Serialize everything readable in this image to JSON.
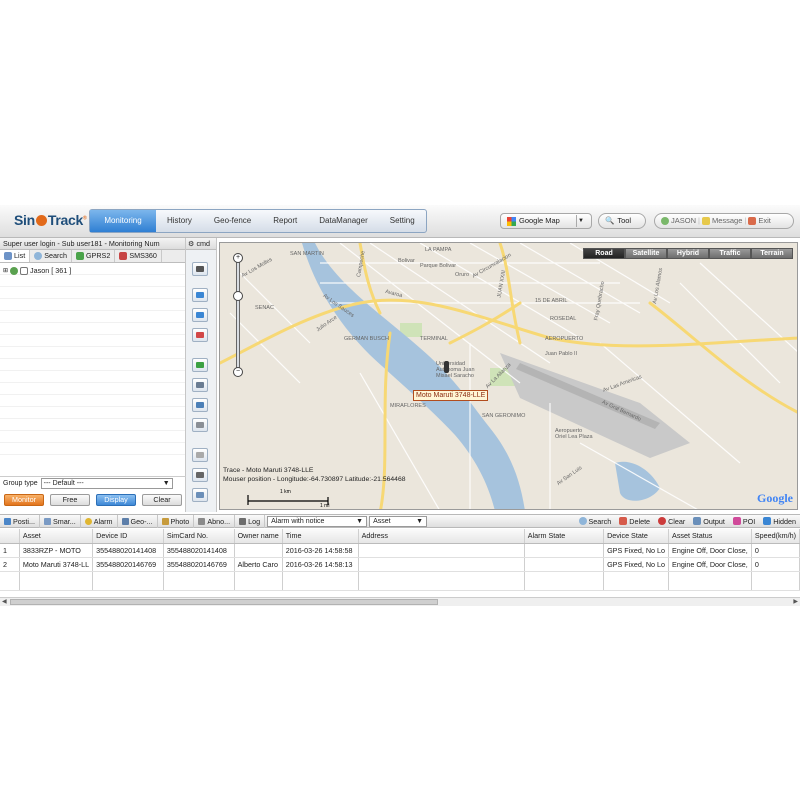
{
  "brand": {
    "name_a": "Sin",
    "name_b": "Track",
    "reg": "®"
  },
  "nav": [
    "Monitoring",
    "History",
    "Geo-fence",
    "Report",
    "DataManager",
    "Setting"
  ],
  "map_select": "Google Map",
  "tool_button": "Tool",
  "user": {
    "name": "JASON",
    "message": "Message",
    "exit": "Exit"
  },
  "left": {
    "title": "Super user login - Sub user181 - Monitoring Num",
    "tabs": [
      "List",
      "Search",
      "GPRS2",
      "SMS360"
    ],
    "tree": [
      {
        "label": "Jason [ 361 ]"
      }
    ],
    "group_label": "Group type",
    "group_value": "--- Default ---",
    "buttons": [
      "Monitor",
      "Free",
      "Display",
      "Clear"
    ]
  },
  "cmd": "cmd",
  "map": {
    "types": [
      "Road",
      "Satellite",
      "Hybrid",
      "Traffic",
      "Terrain"
    ],
    "labels": [
      "SAN MARTIN",
      "LA PAMPA",
      "Parque Bolivar",
      "Bolivar",
      "Campeche",
      "Oruro",
      "Av Circunvalacion",
      "JUAN XXIII",
      "15 DE ABRIL",
      "ROSEDAL",
      "SENAC",
      "Av Los Sauces",
      "Julio Arce",
      "Avaroa",
      "Av Los Molles",
      "GERMAN BUSCH",
      "TERMINAL",
      "AEROPUERTO",
      "Juan Pablo II",
      "Universidad Autonoma Juan Misael Saracho",
      "MIRAFLORES",
      "SAN GERONIMO",
      "Av La Alianza",
      "Aeropuerto Oriel Lea Plaza",
      "Av Las Americas",
      "Av San Luis",
      "Av Gral Bernardo",
      "Av Los Alamos",
      "Fray Quebracho"
    ],
    "vehicle": "Moto Maruti 3748-LLE",
    "trace": "Trace - Moto Maruti 3748-LLE",
    "mouse": "Mouser position - Longitude:-64.730897 Latitude:-21.564468",
    "scale_km": "1 km",
    "scale_mi": "1 mi",
    "google": "Google"
  },
  "grid_tabs": [
    "Posti...",
    "Smar...",
    "Alarm",
    "Geo-...",
    "Photo",
    "Abno...",
    "Log"
  ],
  "grid_selects": [
    "Alarm with notice",
    "Asset"
  ],
  "grid_actions": [
    "Search",
    "Delete",
    "Clear",
    "Output",
    "POI",
    "Hidden"
  ],
  "table": {
    "columns": [
      "",
      "Asset",
      "Device ID",
      "SimCard No.",
      "Owner name",
      "Time",
      "Address",
      "Alarm State",
      "Device State",
      "Asset Status",
      "Speed(km/h)"
    ],
    "rows": [
      [
        "1",
        "3833RZP - MOTO",
        "355488020141408",
        "355488020141408",
        "",
        "2016-03-26 14:58:58",
        "",
        "",
        "GPS Fixed, No Lo",
        "Engine Off, Door Close,",
        "0"
      ],
      [
        "2",
        "Moto Maruti 3748-LL",
        "355488020146769",
        "355488020146769",
        "Alberto Caro",
        "2016-03-26 14:58:13",
        "",
        "",
        "GPS Fixed, No Lo",
        "Engine Off, Door Close,",
        "0"
      ]
    ]
  },
  "colors": {
    "accent": "#2f7fd3",
    "monitor": "#e2741c",
    "river": "#a6c3dd",
    "road": "#f7d874"
  }
}
